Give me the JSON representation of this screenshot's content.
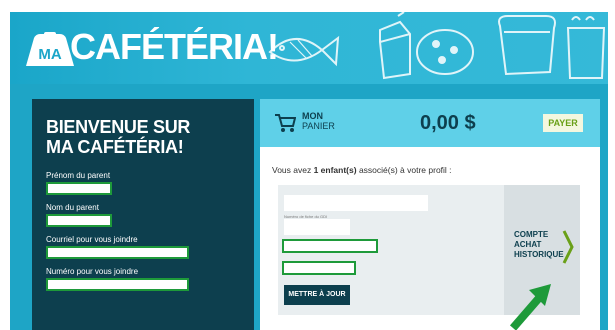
{
  "header": {
    "logo_badge": "MA",
    "logo_text": "CAFÉTÉRIA!"
  },
  "welcome": {
    "title_line1": "BIENVENUE SUR",
    "title_line2": "MA CAFÉTÉRIA!",
    "fields": [
      {
        "label": "Prénom du parent"
      },
      {
        "label": "Nom du parent"
      },
      {
        "label": "Courriel pour vous joindre"
      },
      {
        "label": "Numéro pour vous joindre"
      }
    ]
  },
  "cart": {
    "label_line1": "MON",
    "label_line2": "PANIER",
    "amount": "0,00 $",
    "pay_label": "PAYER"
  },
  "children": {
    "prefix": "Vous avez ",
    "count": "1 enfant(s)",
    "suffix": " associé(s) à votre profil :"
  },
  "profile": {
    "small_label": "Numéro de fiche du GDI",
    "update_label": "METTRE À JOUR"
  },
  "history": {
    "line1": "COMPTE",
    "line2": "ACHAT",
    "line3": "HISTORIQUE"
  },
  "colors": {
    "banner": "#1aa6c9",
    "dark_panel": "#0d3f4e",
    "cart_bar": "#5fd0e8",
    "highlight": "#1e9a3a"
  },
  "icons": [
    "logo-badge-icon",
    "cart-icon",
    "chevron-right-icon",
    "green-arrow-icon"
  ]
}
